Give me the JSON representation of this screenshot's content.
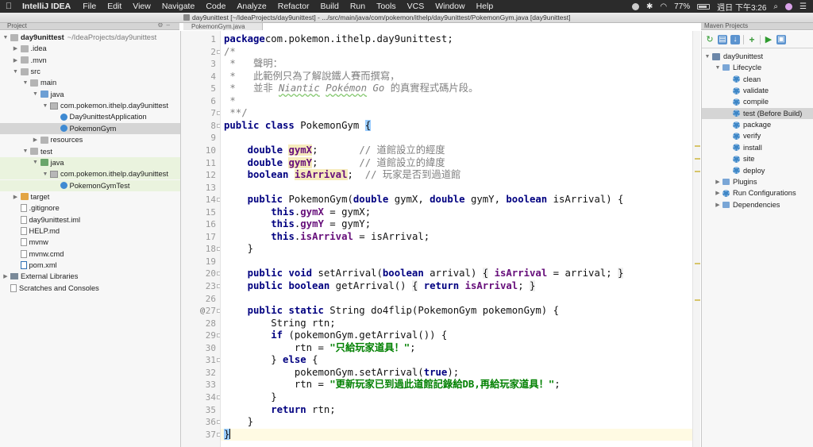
{
  "menubar": {
    "app": "IntelliJ IDEA",
    "items": [
      "File",
      "Edit",
      "View",
      "Navigate",
      "Code",
      "Analyze",
      "Refactor",
      "Build",
      "Run",
      "Tools",
      "VCS",
      "Window",
      "Help"
    ],
    "battery": "77%",
    "clock": "週日 下午3:26"
  },
  "window": {
    "title": "day9unittest [~/IdeaProjects/day9unittest] - .../src/main/java/com/pokemon/ithelp/day9unittest/PokemonGym.java [day9unittest]",
    "tab": "PokemonGym.java"
  },
  "project_panel": {
    "title": "Project",
    "tree": [
      {
        "label": "day9unittest",
        "sub": "~/IdeaProjects/day9unittest",
        "indent": 0,
        "arrow": "▼",
        "icon": "folder-grey",
        "bold": true
      },
      {
        "label": ".idea",
        "indent": 1,
        "arrow": "▶",
        "icon": "folder-grey"
      },
      {
        "label": ".mvn",
        "indent": 1,
        "arrow": "▶",
        "icon": "folder-grey"
      },
      {
        "label": "src",
        "indent": 1,
        "arrow": "▼",
        "icon": "folder-grey"
      },
      {
        "label": "main",
        "indent": 2,
        "arrow": "▼",
        "icon": "folder-grey"
      },
      {
        "label": "java",
        "indent": 3,
        "arrow": "▼",
        "icon": "folder-blue"
      },
      {
        "label": "com.pokemon.ithelp.day9unittest",
        "indent": 4,
        "arrow": "▼",
        "icon": "package"
      },
      {
        "label": "Day9unittestApplication",
        "indent": 5,
        "arrow": "",
        "icon": "class"
      },
      {
        "label": "PokemonGym",
        "indent": 5,
        "arrow": "",
        "icon": "class",
        "selected": true
      },
      {
        "label": "resources",
        "indent": 3,
        "arrow": "▶",
        "icon": "folder-grey"
      },
      {
        "label": "test",
        "indent": 2,
        "arrow": "▼",
        "icon": "folder-grey"
      },
      {
        "label": "java",
        "indent": 3,
        "arrow": "▼",
        "icon": "folder-green",
        "highlight": true
      },
      {
        "label": "com.pokemon.ithelp.day9unittest",
        "indent": 4,
        "arrow": "▼",
        "icon": "package",
        "highlight": true
      },
      {
        "label": "PokemonGymTest",
        "indent": 5,
        "arrow": "",
        "icon": "class",
        "highlight": true
      },
      {
        "label": "target",
        "indent": 1,
        "arrow": "▶",
        "icon": "folder-orange"
      },
      {
        "label": ".gitignore",
        "indent": 1,
        "arrow": "",
        "icon": "file"
      },
      {
        "label": "day9unittest.iml",
        "indent": 1,
        "arrow": "",
        "icon": "file"
      },
      {
        "label": "HELP.md",
        "indent": 1,
        "arrow": "",
        "icon": "file"
      },
      {
        "label": "mvnw",
        "indent": 1,
        "arrow": "",
        "icon": "file"
      },
      {
        "label": "mvnw.cmd",
        "indent": 1,
        "arrow": "",
        "icon": "file"
      },
      {
        "label": "pom.xml",
        "indent": 1,
        "arrow": "",
        "icon": "file-maven"
      },
      {
        "label": "External Libraries",
        "indent": 0,
        "arrow": "▶",
        "icon": "library"
      },
      {
        "label": "Scratches and Consoles",
        "indent": 0,
        "arrow": "",
        "icon": "scratch"
      }
    ]
  },
  "editor": {
    "current_line": 37,
    "override_marker_line": 27,
    "override_marker": "@",
    "lines": [
      {
        "n": 1,
        "segs": [
          [
            "kw",
            "package"
          ],
          [
            "",
            "com.pokemon.ithelp.day9unittest;"
          ]
        ]
      },
      {
        "n": 2,
        "segs": [
          [
            "cmt",
            "/*"
          ]
        ]
      },
      {
        "n": 3,
        "segs": [
          [
            "cmt",
            " *   聲明："
          ]
        ]
      },
      {
        "n": 4,
        "segs": [
          [
            "cmt",
            " *   此範例只為了解說鐵人賽而撰寫，"
          ]
        ]
      },
      {
        "n": 5,
        "segs": [
          [
            "cmt",
            " *   並非 "
          ],
          [
            "cmti wave",
            "Niantic"
          ],
          [
            "cmti",
            " "
          ],
          [
            "cmti wave",
            "Pokémon"
          ],
          [
            "cmti",
            " Go"
          ],
          [
            "cmt",
            " 的真實程式碼片段。"
          ]
        ]
      },
      {
        "n": 6,
        "segs": [
          [
            "cmt",
            " *"
          ]
        ]
      },
      {
        "n": 7,
        "segs": [
          [
            "cmt",
            " **/"
          ]
        ]
      },
      {
        "n": 8,
        "segs": [
          [
            "kw",
            "public class"
          ],
          [
            "",
            " PokemonGym "
          ],
          [
            "brace",
            "{"
          ]
        ]
      },
      {
        "n": 9,
        "segs": []
      },
      {
        "n": 10,
        "segs": [
          [
            "",
            "    "
          ],
          [
            "kw",
            "double"
          ],
          [
            "",
            " "
          ],
          [
            "fld hlf",
            "gymX"
          ],
          [
            "",
            ";       "
          ],
          [
            "cmt",
            "// 道館設立的經度"
          ]
        ]
      },
      {
        "n": 11,
        "segs": [
          [
            "",
            "    "
          ],
          [
            "kw",
            "double"
          ],
          [
            "",
            " "
          ],
          [
            "fld hlf",
            "gymY"
          ],
          [
            "",
            ";       "
          ],
          [
            "cmt",
            "// 道館設立的緯度"
          ]
        ]
      },
      {
        "n": 12,
        "segs": [
          [
            "",
            "    "
          ],
          [
            "kw",
            "boolean"
          ],
          [
            "",
            " "
          ],
          [
            "fld hlf",
            "isArrival"
          ],
          [
            "",
            ";  "
          ],
          [
            "cmt",
            "// 玩家是否到過道館"
          ]
        ]
      },
      {
        "n": 13,
        "segs": []
      },
      {
        "n": 14,
        "segs": [
          [
            "",
            "    "
          ],
          [
            "kw",
            "public"
          ],
          [
            "",
            " PokemonGym("
          ],
          [
            "kw",
            "double"
          ],
          [
            "",
            " gymX, "
          ],
          [
            "kw",
            "double"
          ],
          [
            "",
            " gymY, "
          ],
          [
            "kw",
            "boolean"
          ],
          [
            "",
            " isArrival) {"
          ]
        ]
      },
      {
        "n": 15,
        "segs": [
          [
            "",
            "        "
          ],
          [
            "kw",
            "this"
          ],
          [
            "",
            "."
          ],
          [
            "fld",
            "gymX"
          ],
          [
            "",
            " = gymX;"
          ]
        ]
      },
      {
        "n": 16,
        "segs": [
          [
            "",
            "        "
          ],
          [
            "kw",
            "this"
          ],
          [
            "",
            "."
          ],
          [
            "fld",
            "gymY"
          ],
          [
            "",
            " = gymY;"
          ]
        ]
      },
      {
        "n": 17,
        "segs": [
          [
            "",
            "        "
          ],
          [
            "kw",
            "this"
          ],
          [
            "",
            "."
          ],
          [
            "fld",
            "isArrival"
          ],
          [
            "",
            " = isArrival;"
          ]
        ]
      },
      {
        "n": 18,
        "segs": [
          [
            "",
            "    }"
          ]
        ]
      },
      {
        "n": 19,
        "segs": []
      },
      {
        "n": 20,
        "segs": [
          [
            "",
            "    "
          ],
          [
            "kw",
            "public void"
          ],
          [
            "",
            " setArrival("
          ],
          [
            "kw",
            "boolean"
          ],
          [
            "",
            " arrival) "
          ],
          [
            "dim",
            "{"
          ],
          [
            "",
            " "
          ],
          [
            "fld",
            "isArrival"
          ],
          [
            "",
            " = arrival; "
          ],
          [
            "dim",
            "}"
          ]
        ]
      },
      {
        "n": 23,
        "segs": [
          [
            "",
            "    "
          ],
          [
            "kw",
            "public boolean"
          ],
          [
            "",
            " getArrival() "
          ],
          [
            "dim",
            "{"
          ],
          [
            "",
            " "
          ],
          [
            "kw",
            "return"
          ],
          [
            "",
            " "
          ],
          [
            "fld",
            "isArrival"
          ],
          [
            "",
            "; "
          ],
          [
            "dim",
            "}"
          ]
        ]
      },
      {
        "n": 26,
        "segs": []
      },
      {
        "n": 27,
        "segs": [
          [
            "",
            "    "
          ],
          [
            "kw",
            "public static"
          ],
          [
            "",
            " String do4flip(PokemonGym pokemonGym) {"
          ]
        ]
      },
      {
        "n": 28,
        "segs": [
          [
            "",
            "        String rtn;"
          ]
        ]
      },
      {
        "n": 29,
        "segs": [
          [
            "",
            "        "
          ],
          [
            "kw",
            "if"
          ],
          [
            "",
            " (pokemonGym.getArrival()) {"
          ]
        ]
      },
      {
        "n": 30,
        "segs": [
          [
            "",
            "            rtn = "
          ],
          [
            "str",
            "\"只給玩家道具！\""
          ],
          [
            "",
            ";"
          ]
        ]
      },
      {
        "n": 31,
        "segs": [
          [
            "",
            "        } "
          ],
          [
            "kw",
            "else"
          ],
          [
            "",
            " {"
          ]
        ]
      },
      {
        "n": 32,
        "segs": [
          [
            "",
            "            pokemonGym.setArrival("
          ],
          [
            "kw",
            "true"
          ],
          [
            "",
            ");"
          ]
        ]
      },
      {
        "n": 33,
        "segs": [
          [
            "",
            "            rtn = "
          ],
          [
            "str",
            "\"更新玩家已到過此道館記錄給DB,再給玩家道具！\""
          ],
          [
            "",
            ";"
          ]
        ]
      },
      {
        "n": 34,
        "segs": [
          [
            "",
            "        }"
          ]
        ]
      },
      {
        "n": 35,
        "segs": [
          [
            "",
            "        "
          ],
          [
            "kw",
            "return"
          ],
          [
            "",
            " rtn;"
          ]
        ]
      },
      {
        "n": 36,
        "segs": [
          [
            "",
            "    }"
          ]
        ]
      },
      {
        "n": 37,
        "segs": [
          [
            "brace",
            "}"
          ]
        ]
      }
    ]
  },
  "maven_panel": {
    "title": "Maven Projects",
    "tree": [
      {
        "label": "day9unittest",
        "indent": 0,
        "arrow": "▼",
        "icon": "project"
      },
      {
        "label": "Lifecycle",
        "indent": 1,
        "arrow": "▼",
        "icon": "folder"
      },
      {
        "label": "clean",
        "indent": 2,
        "arrow": "",
        "icon": "gear"
      },
      {
        "label": "validate",
        "indent": 2,
        "arrow": "",
        "icon": "gear"
      },
      {
        "label": "compile",
        "indent": 2,
        "arrow": "",
        "icon": "gear"
      },
      {
        "label": "test (Before Build)",
        "indent": 2,
        "arrow": "",
        "icon": "gear",
        "selected": true
      },
      {
        "label": "package",
        "indent": 2,
        "arrow": "",
        "icon": "gear"
      },
      {
        "label": "verify",
        "indent": 2,
        "arrow": "",
        "icon": "gear"
      },
      {
        "label": "install",
        "indent": 2,
        "arrow": "",
        "icon": "gear"
      },
      {
        "label": "site",
        "indent": 2,
        "arrow": "",
        "icon": "gear"
      },
      {
        "label": "deploy",
        "indent": 2,
        "arrow": "",
        "icon": "gear"
      },
      {
        "label": "Plugins",
        "indent": 1,
        "arrow": "▶",
        "icon": "folder"
      },
      {
        "label": "Run Configurations",
        "indent": 1,
        "arrow": "▶",
        "icon": "gear"
      },
      {
        "label": "Dependencies",
        "indent": 1,
        "arrow": "▶",
        "icon": "folder"
      }
    ]
  }
}
